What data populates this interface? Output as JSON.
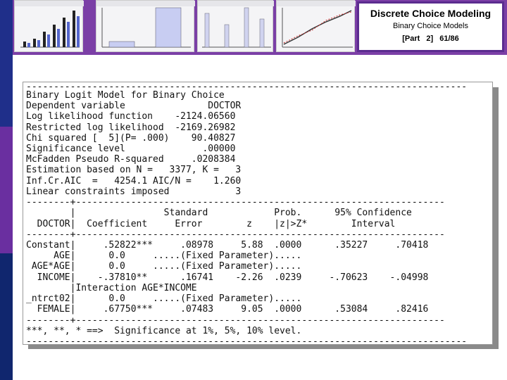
{
  "header": {
    "title": "Discrete Choice Modeling",
    "subtitle": "Binary Choice Models",
    "slide_ref": "[Part 2] 61/86"
  },
  "output": {
    "lines": [
      "--------------------------------------------------------------------------------",
      "Binary Logit Model for Binary Choice",
      "Dependent variable               DOCTOR",
      "Log likelihood function    -2124.06560",
      "Restricted log likelihood  -2169.26982",
      "Chi squared [  5](P= .000)    90.40827",
      "Significance level              .00000",
      "McFadden Pseudo R-squared     .0208384",
      "Estimation based on N =   3377, K =   3",
      "Inf.Cr.AIC  =   4254.1 AIC/N =    1.260",
      "Linear constraints imposed            3",
      "--------+-------------------------------------------------------------------",
      "        |                Standard            Prob.      95% Confidence",
      "  DOCTOR|  Coefficient     Error        z    |z|>Z*        Interval",
      "--------+-------------------------------------------------------------------",
      "Constant|     .52822***     .08978     5.88  .0000      .35227     .70418",
      "     AGE|      0.0     .....(Fixed Parameter).....",
      " AGE*AGE|      0.0     .....(Fixed Parameter).....",
      "  INCOME|    -.37810**      .16741    -2.26  .0239     -.70623    -.04998",
      "        |Interaction AGE*INCOME",
      "_ntrct02|      0.0     .....(Fixed Parameter).....",
      "  FEMALE|     .67750***     .07483     9.05  .0000      .53084     .82416",
      "--------+-------------------------------------------------------------------",
      "***, **, * ==>  Significance at 1%, 5%, 10% level.",
      "--------------------------------------------------------------------------------"
    ]
  },
  "colors": {
    "accent_purple": "#7b3fa6",
    "side_blue": "#1f3a93"
  }
}
